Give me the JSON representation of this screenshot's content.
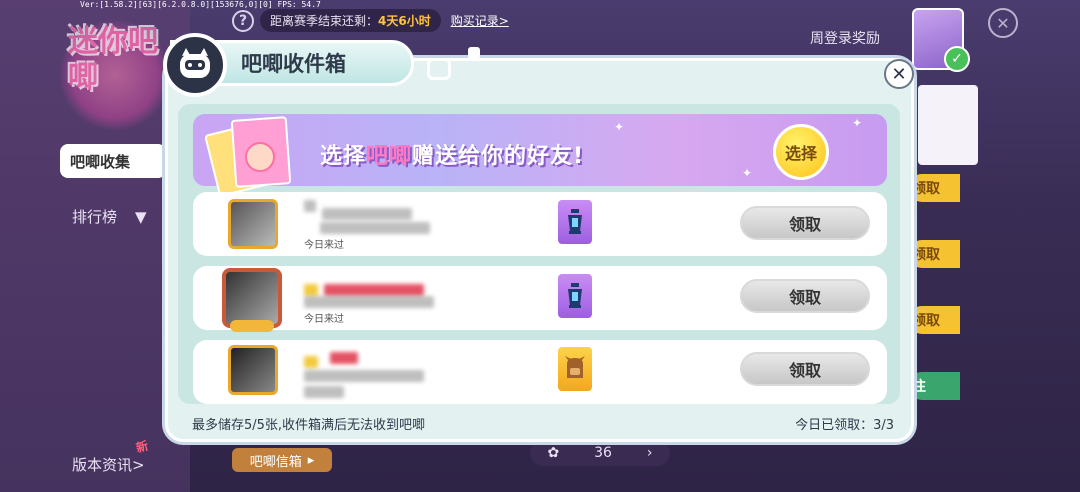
{
  "debug_text": "Ver:[1.58.2][63][6.2.0.8.0][153676,0][0] FPS: 54.7",
  "season": {
    "prefix": "距离赛季结束还剩：",
    "remaining": "4天6小时"
  },
  "buy_record": "购买记录>",
  "weekly_login": "周登录奖励",
  "logo_text": "迷你吧唧",
  "sidebar": {
    "collection_tab": "吧唧收集",
    "ranking": "排行榜",
    "version_info": "版本资讯>",
    "new_tag": "新"
  },
  "letter_box": "吧唧信箱",
  "count_value": "36",
  "right_buttons": [
    "领取",
    "领取",
    "领取"
  ],
  "right_green_label": "往",
  "dialog": {
    "title": "吧唧收件箱",
    "banner_text_a": "选择",
    "banner_text_b": "吧唧",
    "banner_text_c": "赠送给你的好友!",
    "banner_button": "选择",
    "rows": [
      {
        "sub_text": "今日来过",
        "claim_label": "领取"
      },
      {
        "sub_text": "今日来过",
        "claim_label": "领取"
      },
      {
        "sub_text": "",
        "claim_label": "领取"
      }
    ],
    "footer_left": "最多储存5/5张,收件箱满后无法收到吧唧",
    "footer_right": "今日已领取：3/3"
  },
  "colors": {
    "accent": "#f5c232",
    "dialog_bg": "#e3f2f1",
    "banner": "#c9a5f4"
  },
  "icons": [
    "help-icon",
    "close-icon",
    "check-icon",
    "lantern-icon",
    "backpack-icon",
    "select-badge-icon",
    "dropdown-icon"
  ]
}
